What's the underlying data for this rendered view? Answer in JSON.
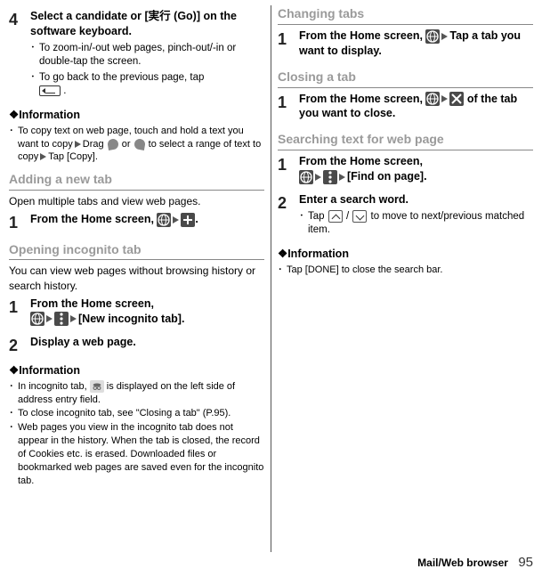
{
  "left": {
    "step4": {
      "num": "4",
      "head": "Select a candidate or [実行 (Go)] on the software keyboard.",
      "b1": "To zoom-in/-out web pages, pinch-out/-in or double-tap the screen.",
      "b2a": "To go back to the previous page, tap ",
      "b2b": " ."
    },
    "info1": {
      "head": "❖Information",
      "r1a": "To copy text on web page, touch and hold a text you want to copy",
      "r1b": "Drag ",
      "r1c": " or ",
      "r1d": " to select a range of text to copy",
      "r1e": "Tap [Copy]."
    },
    "sec_add": {
      "head": "Adding a new tab",
      "desc": "Open multiple tabs and view web pages."
    },
    "step1a": {
      "num": "1",
      "a": "From the Home screen, ",
      "b": "."
    },
    "sec_inc": {
      "head": "Opening incognito tab",
      "desc": "You can view web pages without browsing history or search history."
    },
    "step1b": {
      "num": "1",
      "a": "From the Home screen, ",
      "b": "[New incognito tab]."
    },
    "step2b": {
      "num": "2",
      "head": "Display a web page."
    },
    "info2": {
      "head": "❖Information",
      "r1": "In incognito tab, ",
      "r1b": " is displayed on the left side of address entry field.",
      "r2": "To close incognito tab, see \"Closing a tab\" (P.95).",
      "r3": "Web pages you view in the incognito tab does not appear in the history. When the tab is closed, the record of Cookies etc. is erased. Downloaded files or bookmarked web pages are saved even for the incognito tab."
    }
  },
  "right": {
    "sec_ch": {
      "head": "Changing tabs"
    },
    "step1c": {
      "num": "1",
      "a": "From the Home screen, ",
      "b": "Tap a tab you want to display."
    },
    "sec_cl": {
      "head": "Closing a tab"
    },
    "step1d": {
      "num": "1",
      "a": "From the Home screen, ",
      "b": " of the tab you want to close."
    },
    "sec_se": {
      "head": "Searching text for web page"
    },
    "step1e": {
      "num": "1",
      "a": "From the Home screen, ",
      "b": "[Find on page]."
    },
    "step2e": {
      "num": "2",
      "head": "Enter a search word.",
      "b1a": "Tap ",
      "b1b": " / ",
      "b1c": " to move to next/previous matched item."
    },
    "info3": {
      "head": "❖Information",
      "r1": "Tap [DONE] to close the search bar."
    }
  },
  "footer": {
    "section": "Mail/Web browser",
    "page": "95"
  }
}
